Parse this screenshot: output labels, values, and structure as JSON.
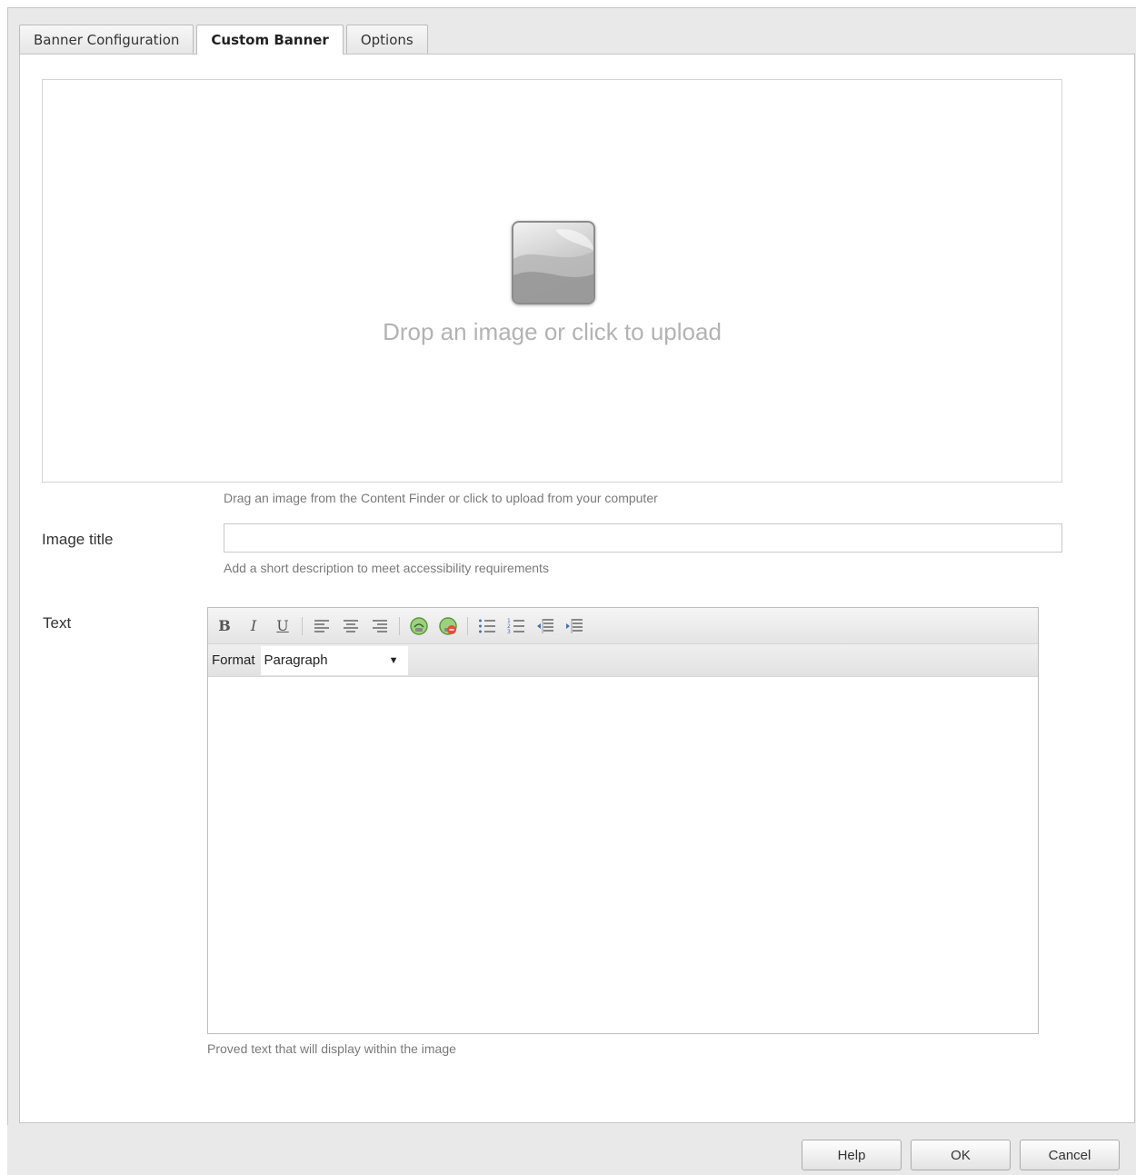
{
  "tabs": [
    {
      "label": "Banner Configuration",
      "active": false
    },
    {
      "label": "Custom Banner",
      "active": true
    },
    {
      "label": "Options",
      "active": false
    }
  ],
  "upload": {
    "drop_text": "Drop an image or click to upload",
    "hint": "Drag an image from the Content Finder or click to upload from your computer",
    "icon": "image-placeholder-icon"
  },
  "image_title": {
    "label": "Image title",
    "value": "",
    "hint": "Add a short description to meet accessibility requirements"
  },
  "text_field": {
    "label": "Text",
    "format_label": "Format",
    "format_value": "Paragraph",
    "hint": "Proved text that will display within the image",
    "toolbar": {
      "bold": "B",
      "italic": "I",
      "underline": "U",
      "icons": [
        "bold-icon",
        "italic-icon",
        "underline-icon",
        "align-left-icon",
        "align-center-icon",
        "align-right-icon",
        "link-icon",
        "unlink-icon",
        "bulleted-list-icon",
        "numbered-list-icon",
        "outdent-icon",
        "indent-icon"
      ]
    }
  },
  "footer": {
    "help": "Help",
    "ok": "OK",
    "cancel": "Cancel"
  },
  "colors": {
    "dialog_bg": "#e9e9e9",
    "panel_bg": "#ffffff",
    "drop_text": "#b3b3b3",
    "hint_text": "#7a7a7a",
    "link_icon_green": "#5a9a3c",
    "unlink_icon_red": "#c0392b",
    "list_icon_blue": "#4a6fb5"
  }
}
